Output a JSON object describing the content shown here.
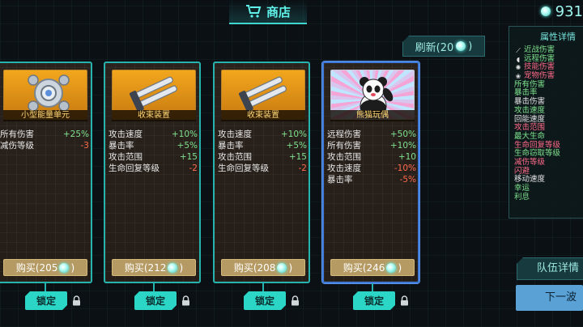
{
  "header": {
    "title": "商店",
    "currency_value": "931"
  },
  "refresh": {
    "label": "刷新(20",
    "suffix": ")"
  },
  "cards": [
    {
      "name": "小型能量单元",
      "icon": "energy-unit-icon",
      "stats": [
        {
          "name": "所有伤害",
          "value": "+25%",
          "type": "pos"
        },
        {
          "name": "减伤等级",
          "value": "-3",
          "type": "neg"
        }
      ],
      "buy_label": "购买(205",
      "buy_suffix": ")",
      "lock_label": "锁定"
    },
    {
      "name": "收束装置",
      "icon": "converge-device-icon",
      "stats": [
        {
          "name": "攻击速度",
          "value": "+10%",
          "type": "pos"
        },
        {
          "name": "暴击率",
          "value": "+5%",
          "type": "pos"
        },
        {
          "name": "攻击范围",
          "value": "+15",
          "type": "pos"
        },
        {
          "name": "生命回复等级",
          "value": "-2",
          "type": "neg"
        }
      ],
      "buy_label": "购买(212",
      "buy_suffix": ")",
      "lock_label": "锁定"
    },
    {
      "name": "收束装置",
      "icon": "converge-device-icon",
      "stats": [
        {
          "name": "攻击速度",
          "value": "+10%",
          "type": "pos"
        },
        {
          "name": "暴击率",
          "value": "+5%",
          "type": "pos"
        },
        {
          "name": "攻击范围",
          "value": "+15",
          "type": "pos"
        },
        {
          "name": "生命回复等级",
          "value": "-2",
          "type": "neg"
        }
      ],
      "buy_label": "购买(208",
      "buy_suffix": ")",
      "lock_label": "锁定"
    },
    {
      "name": "熊猫玩偶",
      "icon": "panda-doll-icon",
      "stats": [
        {
          "name": "远程伤害",
          "value": "+50%",
          "type": "pos"
        },
        {
          "name": "所有伤害",
          "value": "+10%",
          "type": "pos"
        },
        {
          "name": "攻击范围",
          "value": "+10",
          "type": "pos"
        },
        {
          "name": "攻击速度",
          "value": "-10%",
          "type": "neg"
        },
        {
          "name": "暴击率",
          "value": "-5%",
          "type": "neg"
        }
      ],
      "buy_label": "购买(246",
      "buy_suffix": ")",
      "lock_label": "锁定"
    }
  ],
  "attributes": {
    "title": "属性详情",
    "items": [
      {
        "label": "近战伤害",
        "color": "#7fe18e",
        "icon": "sword-icon"
      },
      {
        "label": "远程伤害",
        "color": "#7fe18e",
        "icon": "bow-icon"
      },
      {
        "label": "技能伤害",
        "color": "#ff6b8a",
        "icon": "skill-icon"
      },
      {
        "label": "宠物伤害",
        "color": "#ff6b8a",
        "icon": "pet-icon"
      },
      {
        "label": "所有伤害",
        "color": "#7fe18e"
      },
      {
        "label": "暴击率",
        "color": "#7fe18e"
      },
      {
        "label": "暴击伤害",
        "color": "#e3e3e3"
      },
      {
        "label": "攻击速度",
        "color": "#7fe18e"
      },
      {
        "label": "回能速度",
        "color": "#e3e3e3"
      },
      {
        "label": "攻击范围",
        "color": "#ff6b8a"
      },
      {
        "label": "最大生命",
        "color": "#7fe18e"
      },
      {
        "label": "生命回复等级",
        "color": "#ff6b8a"
      },
      {
        "label": "生命窃取等级",
        "color": "#7fe18e"
      },
      {
        "label": "减伤等级",
        "color": "#ff6b8a"
      },
      {
        "label": "闪避",
        "color": "#ff6b8a"
      },
      {
        "label": "移动速度",
        "color": "#e3e3e3"
      },
      {
        "label": "幸运",
        "color": "#7fe18e"
      },
      {
        "label": "利息",
        "color": "#7fe18e"
      }
    ]
  },
  "team_details_label": "队伍详情",
  "next_wave_label": "下一波"
}
